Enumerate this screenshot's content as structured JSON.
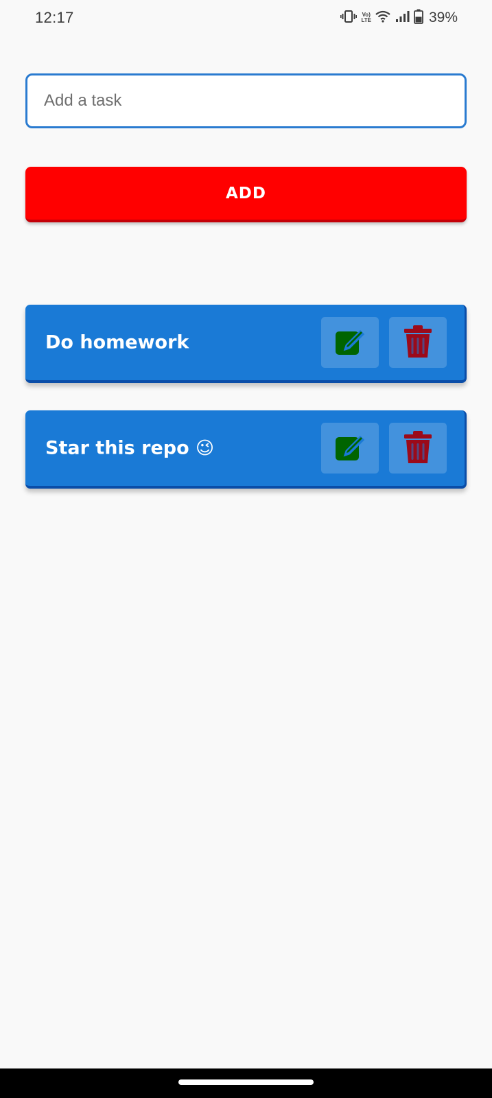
{
  "status_bar": {
    "time": "12:17",
    "volte_top": "Vo)",
    "volte_bottom": "LTE",
    "battery_percent": "39%",
    "icons": [
      "vibrate-icon",
      "volte-icon",
      "wifi-icon",
      "signal-icon",
      "battery-icon"
    ]
  },
  "input": {
    "placeholder": "Add a task",
    "value": ""
  },
  "add_button": {
    "label": "ADD",
    "color": "#ff0000"
  },
  "tasks": [
    {
      "text": "Do homework",
      "emoji": ""
    },
    {
      "text": "Star this repo ",
      "emoji": "😉"
    }
  ],
  "colors": {
    "card": "#1a7ad6",
    "edit_icon": "#006400",
    "delete_icon": "#9b0a1a",
    "input_border": "#2a7bd0"
  }
}
